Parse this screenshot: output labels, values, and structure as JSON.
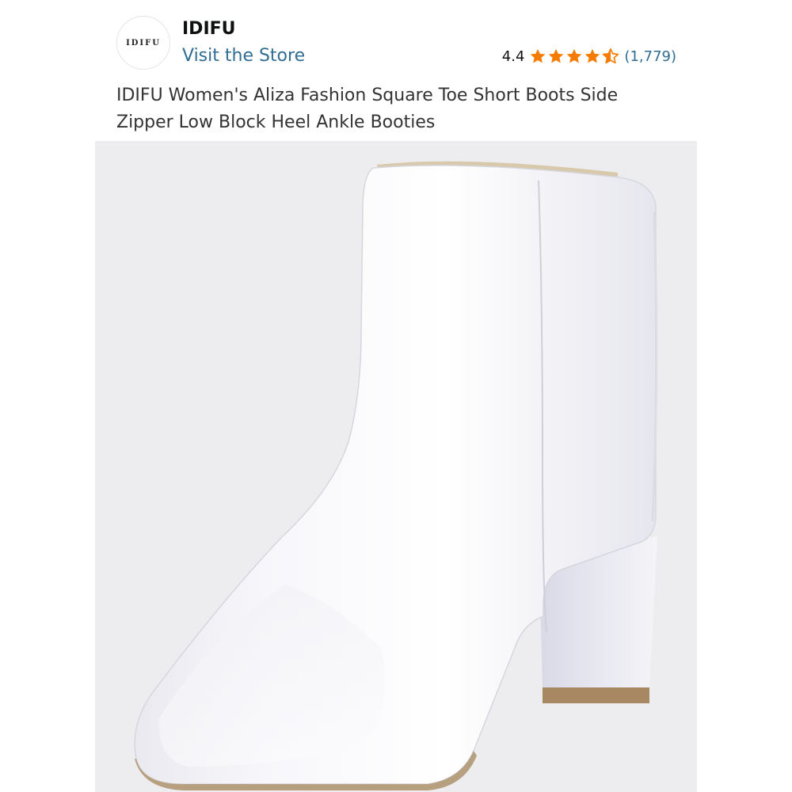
{
  "brand": {
    "logo_text": "IDIFU",
    "name": "IDIFU",
    "store_link": "Visit the Store"
  },
  "rating": {
    "value": "4.4",
    "stars": 4.4,
    "count": "(1,779)",
    "star_color": "#f57c00"
  },
  "product": {
    "title": "IDIFU Women's Aliza Fashion Square Toe Short Boots Side Zipper Low Block Heel Ankle Booties",
    "image_icon": "white-ankle-boot"
  },
  "colors": {
    "link": "#2f6d92",
    "text": "#0f1111",
    "image_bg": "#ededf0"
  }
}
